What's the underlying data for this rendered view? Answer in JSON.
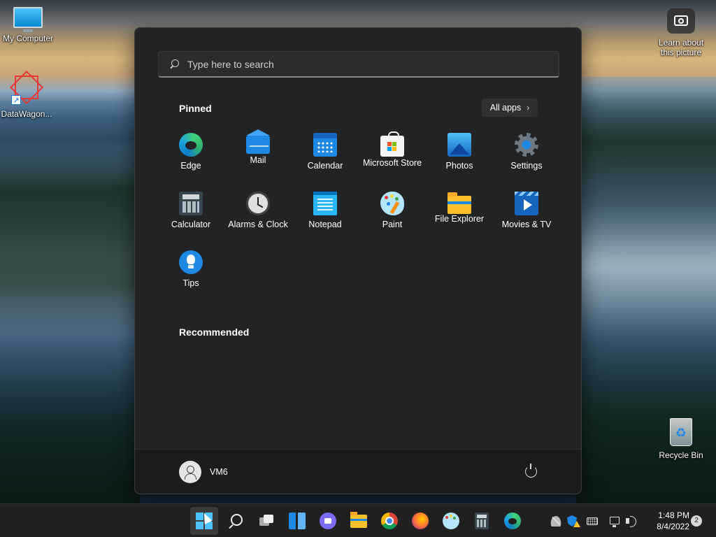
{
  "desktop": {
    "icons": [
      {
        "label": "My Computer",
        "icon": "monitor-icon"
      },
      {
        "label": "DataWagon...",
        "icon": "datawagon-logo-icon"
      },
      {
        "label": "Learn about this picture",
        "icon": "camera-icon"
      },
      {
        "label": "Recycle Bin",
        "icon": "recycle-bin-icon"
      }
    ]
  },
  "start_menu": {
    "search": {
      "placeholder": "Type here to search"
    },
    "pinned_title": "Pinned",
    "all_apps_label": "All apps",
    "pinned_apps": [
      {
        "label": "Edge",
        "icon": "edge-icon"
      },
      {
        "label": "Mail",
        "icon": "mail-icon"
      },
      {
        "label": "Calendar",
        "icon": "calendar-icon"
      },
      {
        "label": "Microsoft Store",
        "icon": "store-icon"
      },
      {
        "label": "Photos",
        "icon": "photos-icon"
      },
      {
        "label": "Settings",
        "icon": "gear-icon"
      },
      {
        "label": "Calculator",
        "icon": "calculator-icon"
      },
      {
        "label": "Alarms & Clock",
        "icon": "clock-icon"
      },
      {
        "label": "Notepad",
        "icon": "notepad-icon"
      },
      {
        "label": "Paint",
        "icon": "paint-palette-icon"
      },
      {
        "label": "File Explorer",
        "icon": "folder-icon"
      },
      {
        "label": "Movies & TV",
        "icon": "movies-play-icon"
      },
      {
        "label": "Tips",
        "icon": "lightbulb-icon"
      }
    ],
    "recommended_title": "Recommended",
    "user": {
      "name": "VM6"
    }
  },
  "taskbar": {
    "apps": [
      "start-icon",
      "search-icon",
      "task-view-icon",
      "widgets-icon",
      "chat-icon",
      "file-explorer-icon",
      "chrome-icon",
      "firefox-icon",
      "paint-icon",
      "calculator-icon",
      "edge-icon"
    ],
    "tray": [
      "onedrive-off-icon",
      "security-warning-icon",
      "keyboard-icon",
      "network-icon",
      "volume-icon"
    ],
    "time": "1:48 PM",
    "date": "8/4/2022",
    "notifications": "2"
  }
}
